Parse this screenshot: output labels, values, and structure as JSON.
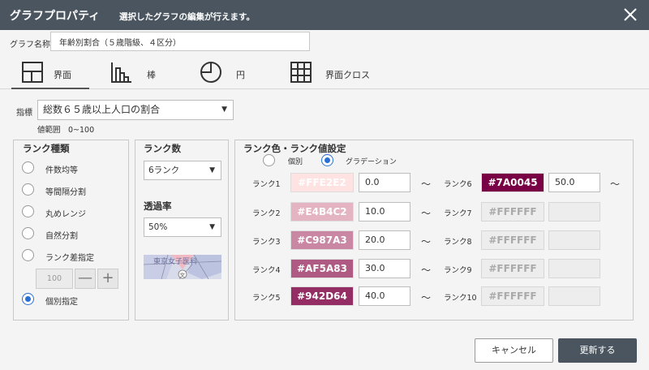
{
  "title": {
    "main": "グラフプロパティ",
    "sub": "選択したグラフの編集が行えます。"
  },
  "graph_name": {
    "label": "グラフ名称",
    "value": "年齢別割合（５歳階級、４区分）"
  },
  "tabs": [
    {
      "label": "界面",
      "icon": "layout-icon"
    },
    {
      "label": "棒",
      "icon": "bar-chart-icon"
    },
    {
      "label": "円",
      "icon": "pie-chart-icon"
    },
    {
      "label": "界面クロス",
      "icon": "grid-icon"
    }
  ],
  "indicator": {
    "label": "指標",
    "value": "総数６５歳以上人口の割合",
    "range": "値範囲　0~100"
  },
  "rank_type": {
    "title": "ランク種類",
    "options": [
      "件数均等",
      "等間隔分割",
      "丸めレンジ",
      "自然分割",
      "ランク差指定",
      "個別指定"
    ],
    "selected": "個別指定",
    "stepper_value": "100",
    "minus": "—",
    "plus": "+"
  },
  "rank_count": {
    "title": "ランク数",
    "value": "6ランク",
    "opacity_title": "透過率",
    "opacity_value": "50%",
    "preview_text": "東京女子医科",
    "preview_mark": "文"
  },
  "rank_color": {
    "title": "ランク色・ランク値設定",
    "mode_individual": "個別",
    "mode_gradient": "グラデーション",
    "selected_mode": "グラデーション",
    "tilde": "～",
    "ranks": [
      {
        "label": "ランク1",
        "color": "#FFE2E2",
        "value": "0.0"
      },
      {
        "label": "ランク2",
        "color": "#E4B4C2",
        "value": "10.0"
      },
      {
        "label": "ランク3",
        "color": "#C987A3",
        "value": "20.0"
      },
      {
        "label": "ランク4",
        "color": "#AF5A83",
        "value": "30.0"
      },
      {
        "label": "ランク5",
        "color": "#942D64",
        "value": "40.0"
      },
      {
        "label": "ランク6",
        "color": "#7A0045",
        "value": "50.0"
      },
      {
        "label": "ランク7",
        "color": "#FFFFFF",
        "value": ""
      },
      {
        "label": "ランク8",
        "color": "#FFFFFF",
        "value": ""
      },
      {
        "label": "ランク9",
        "color": "#FFFFFF",
        "value": ""
      },
      {
        "label": "ランク10",
        "color": "#FFFFFF",
        "value": ""
      }
    ]
  },
  "buttons": {
    "cancel": "キャンセル",
    "update": "更新する"
  }
}
